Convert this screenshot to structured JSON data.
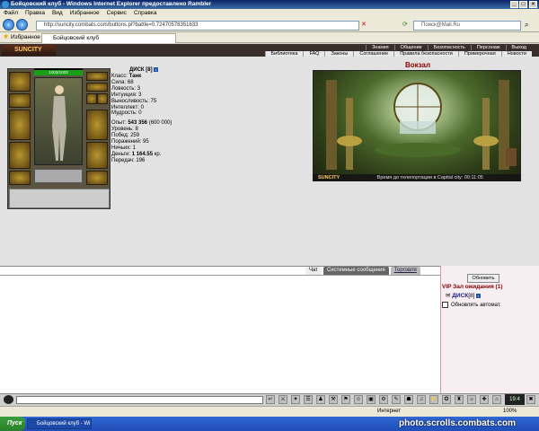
{
  "window": {
    "title": "Бойцовский клуб - Windows Internet Explorer предоставлено Rambler",
    "menu": [
      "Файл",
      "Правка",
      "Вид",
      "Избранное",
      "Сервис",
      "Справка"
    ],
    "address": "http://suncity.combats.com/buttons.pl?battle=0.72470578351633",
    "search_placeholder": "Поиск@Mail.Ru",
    "favorites_label": "Избранное",
    "tab_label": "Бойцовский клуб"
  },
  "game_header": {
    "logo": "SUNCITY",
    "nav_top": [
      "Знания",
      "Общение",
      "Безопасность",
      "Персонаж",
      "Выход"
    ],
    "nav_bottom": [
      "Библиотека",
      "FAQ",
      "Законы",
      "Соглашение",
      "Правила безопасности",
      "Примерочная",
      "Новости"
    ]
  },
  "character": {
    "name": "ДИСК",
    "level": "[8]",
    "hp": "1003/1003",
    "class_label": "Класс:",
    "class_value": "Танк",
    "stats": [
      {
        "label": "Сила:",
        "value": "68"
      },
      {
        "label": "Ловкость:",
        "value": "3"
      },
      {
        "label": "Интуиция:",
        "value": "3"
      },
      {
        "label": "Выносливость:",
        "value": "75"
      },
      {
        "label": "Интеллект:",
        "value": "0"
      },
      {
        "label": "Мудрость:",
        "value": "0"
      }
    ],
    "exp_label": "Опыт:",
    "exp_value": "543 356",
    "exp_next": "(600 000)",
    "level_label": "Уровень:",
    "level_value": "8",
    "wins_label": "Побед:",
    "wins_value": "259",
    "losses_label": "Поражений:",
    "losses_value": "95",
    "draws_label": "Ничьих:",
    "draws_value": "1",
    "money_label": "Деньги:",
    "money_value": "1 164.55",
    "money_unit": "кр.",
    "transfers_label": "Передач:",
    "transfers_value": "196"
  },
  "location": {
    "title": "Вокзал",
    "caption_brand": "SUNCITY",
    "caption_text": "Время до телепортации в Capital city: 00:11:05"
  },
  "chat": {
    "tabs": [
      "Чат",
      "Системные сообщения",
      "Торговля"
    ]
  },
  "side": {
    "refresh_label": "Обновить",
    "vip_title": "VIP Зал ожидания (1)",
    "vip_user": "ДИСК",
    "vip_level": "[8]",
    "auto_refresh_label": "Обновлять автомат."
  },
  "clock": "19:4",
  "statusbar": {
    "zone": "Интернет",
    "zoom": "100%"
  },
  "taskbar": {
    "start": "Пуск",
    "task": "Бойцовский клуб - Wi...",
    "watermark": "photo.scrolls.combats.com"
  },
  "colors": {
    "location_title": "#8a0000",
    "vip_title": "#8a0000",
    "hp_bar": "#17a017"
  }
}
